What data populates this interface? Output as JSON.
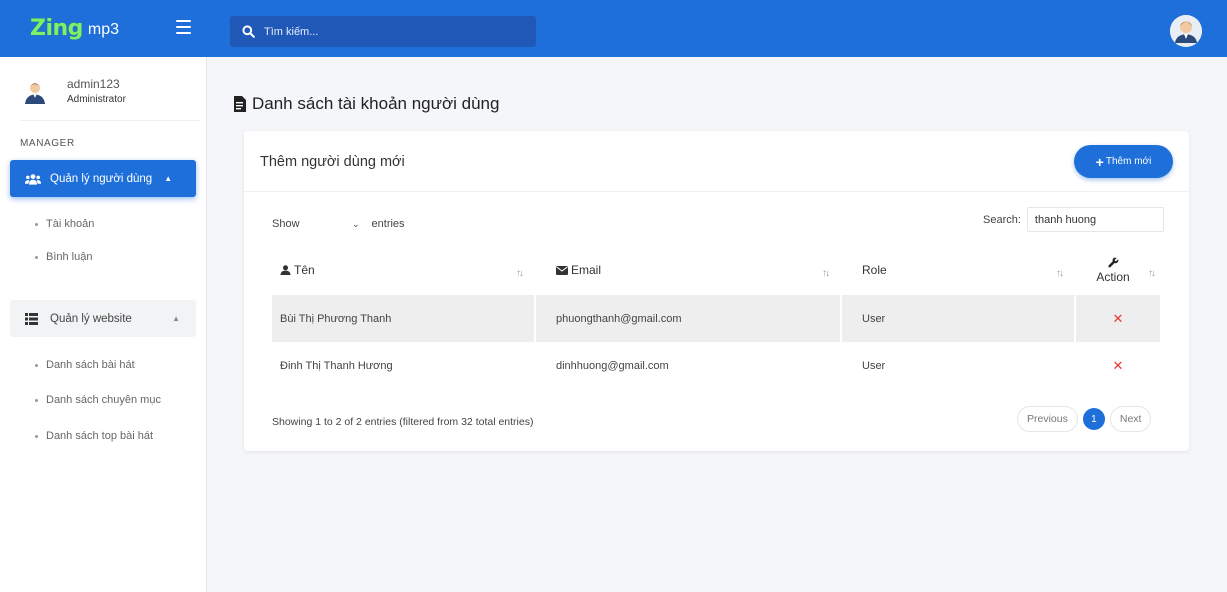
{
  "brand": {
    "logo": "Zing",
    "suffix": "mp3"
  },
  "topbar": {
    "search_placeholder": "Tìm kiếm..."
  },
  "sidebar": {
    "user": {
      "name": "admin123",
      "role": "Administrator"
    },
    "section_label": "MANAGER",
    "menu_users": {
      "label": "Quản lý người dùng",
      "icon": "users-icon"
    },
    "users_sub": [
      "Tài khoản",
      "Bình luận"
    ],
    "menu_website": {
      "label": "Quản lý website",
      "icon": "list-icon"
    },
    "website_sub": [
      "Danh sách bài hát",
      "Danh sách chuyên mục",
      "Danh sách top bài hát"
    ]
  },
  "page": {
    "title": "Danh sách tài khoản người dùng"
  },
  "card": {
    "title": "Thêm người dùng mới",
    "add_button": "Thêm mới",
    "show_label": "Show",
    "entries_label": "entries",
    "search_label": "Search:",
    "search_value": "thanh huong",
    "columns": {
      "name": "Tên",
      "email": "Email",
      "role": "Role",
      "action": "Action"
    },
    "rows": [
      {
        "name": "Bùi Thị Phương Thanh",
        "email": "phuongthanh@gmail.com",
        "role": "User"
      },
      {
        "name": "Đinh Thị Thanh Hương",
        "email": "dinhhuong@gmail.com",
        "role": "User"
      }
    ],
    "delete_glyph": "✕",
    "info": "Showing 1 to 2 of 2 entries (filtered from 32 total entries)",
    "pagination": {
      "previous": "Previous",
      "current": "1",
      "next": "Next"
    }
  },
  "colors": {
    "primary": "#1e6fd9",
    "brand_green": "#7df06a",
    "delete": "#e53935"
  }
}
